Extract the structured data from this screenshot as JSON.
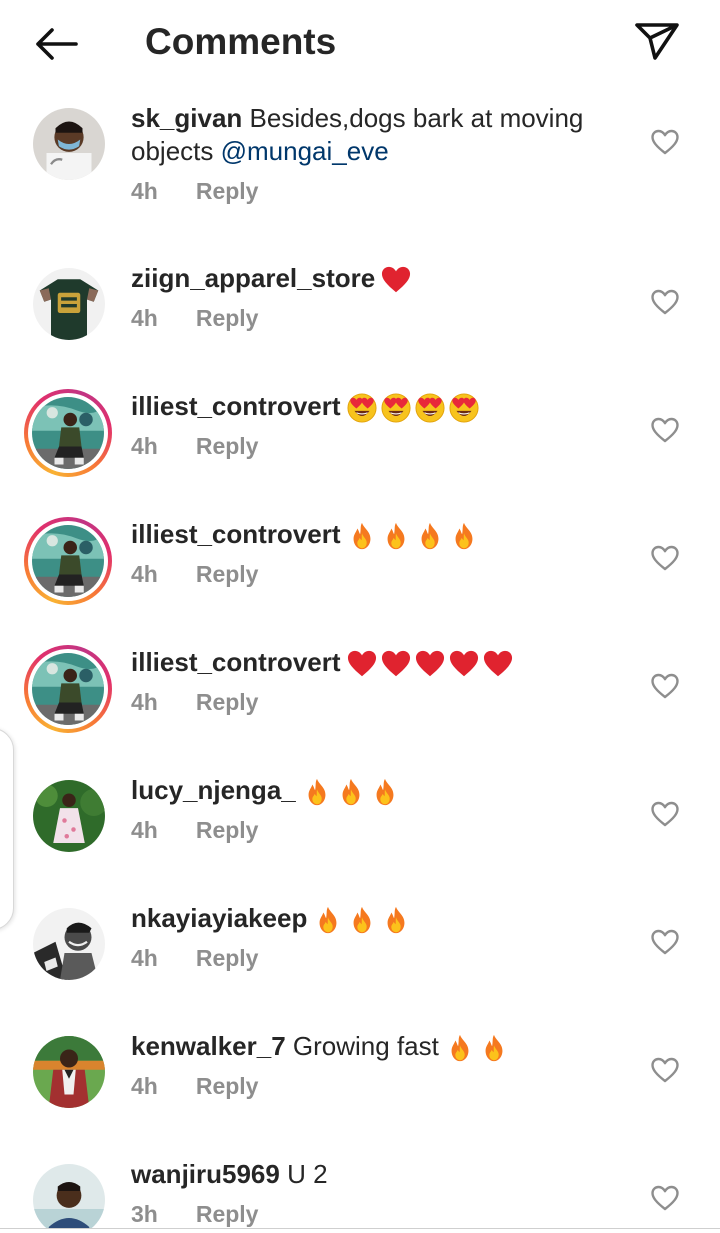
{
  "header": {
    "title": "Comments",
    "back_icon": "arrow-left-icon",
    "share_icon": "paper-plane-icon"
  },
  "comments": [
    {
      "username": "sk_givan",
      "text": "Besides,dogs bark at moving objects",
      "mention": "@mungai_eve",
      "time": "4h",
      "reply": "Reply"
    },
    {
      "username": "ziign_apparel_store",
      "emojis": [
        "red-heart"
      ],
      "time": "4h",
      "reply": "Reply"
    },
    {
      "username": "illiest_controvert",
      "emojis": [
        "heart-eyes",
        "heart-eyes",
        "heart-eyes",
        "heart-eyes"
      ],
      "time": "4h",
      "reply": "Reply"
    },
    {
      "username": "illiest_controvert",
      "emojis": [
        "fire",
        "fire",
        "fire",
        "fire"
      ],
      "time": "4h",
      "reply": "Reply"
    },
    {
      "username": "illiest_controvert",
      "emojis": [
        "red-heart",
        "red-heart",
        "red-heart",
        "red-heart",
        "red-heart"
      ],
      "time": "4h",
      "reply": "Reply"
    },
    {
      "username": "lucy_njenga_",
      "emojis": [
        "fire",
        "fire",
        "fire"
      ],
      "time": "4h",
      "reply": "Reply"
    },
    {
      "username": "nkayiayiakeep",
      "emojis": [
        "fire",
        "fire",
        "fire"
      ],
      "time": "4h",
      "reply": "Reply"
    },
    {
      "username": "kenwalker_7",
      "text": "Growing fast",
      "emojis": [
        "fire",
        "fire"
      ],
      "time": "4h",
      "reply": "Reply"
    },
    {
      "username": "wanjiru5969",
      "text": "U 2",
      "time": "3h",
      "reply": "Reply"
    }
  ],
  "colors": {
    "text": "#262626",
    "meta": "#8e8e8e",
    "mention": "#00376b",
    "heart": "#e0232f"
  }
}
